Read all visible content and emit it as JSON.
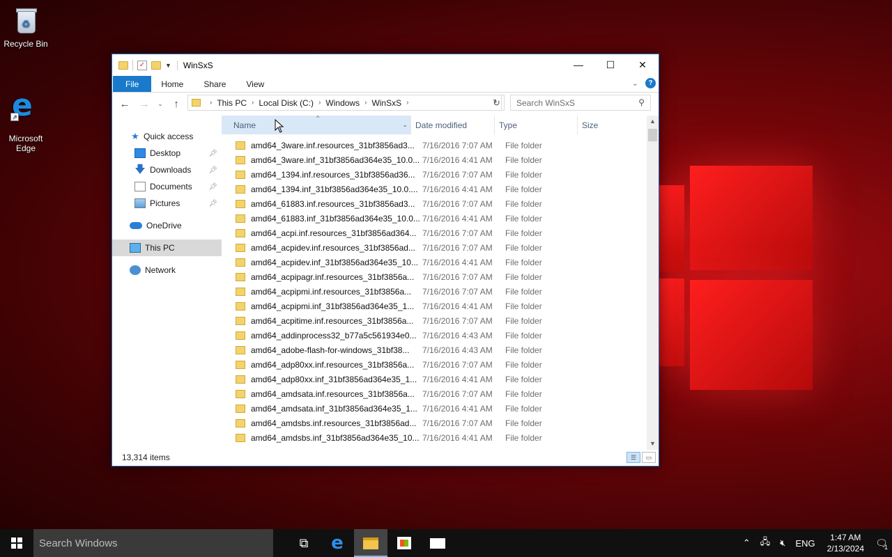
{
  "desktop": {
    "icons": [
      {
        "label": "Recycle Bin"
      },
      {
        "label": "Microsoft\nEdge"
      }
    ]
  },
  "window": {
    "title": "WinSxS",
    "ribbon_tabs": [
      "File",
      "Home",
      "Share",
      "View"
    ],
    "breadcrumbs": [
      "This PC",
      "Local Disk (C:)",
      "Windows",
      "WinSxS"
    ],
    "search_placeholder": "Search WinSxS",
    "columns": {
      "name": "Name",
      "date": "Date modified",
      "type": "Type",
      "size": "Size"
    },
    "sidebar": {
      "quick_access": "Quick access",
      "pinned": [
        "Desktop",
        "Downloads",
        "Documents",
        "Pictures"
      ],
      "onedrive": "OneDrive",
      "this_pc": "This PC",
      "network": "Network"
    },
    "files": [
      {
        "name": "amd64_3ware.inf.resources_31bf3856ad3...",
        "date": "7/16/2016 7:07 AM",
        "type": "File folder"
      },
      {
        "name": "amd64_3ware.inf_31bf3856ad364e35_10.0...",
        "date": "7/16/2016 4:41 AM",
        "type": "File folder"
      },
      {
        "name": "amd64_1394.inf.resources_31bf3856ad36...",
        "date": "7/16/2016 7:07 AM",
        "type": "File folder"
      },
      {
        "name": "amd64_1394.inf_31bf3856ad364e35_10.0....",
        "date": "7/16/2016 4:41 AM",
        "type": "File folder"
      },
      {
        "name": "amd64_61883.inf.resources_31bf3856ad3...",
        "date": "7/16/2016 7:07 AM",
        "type": "File folder"
      },
      {
        "name": "amd64_61883.inf_31bf3856ad364e35_10.0...",
        "date": "7/16/2016 4:41 AM",
        "type": "File folder"
      },
      {
        "name": "amd64_acpi.inf.resources_31bf3856ad364...",
        "date": "7/16/2016 7:07 AM",
        "type": "File folder"
      },
      {
        "name": "amd64_acpidev.inf.resources_31bf3856ad...",
        "date": "7/16/2016 7:07 AM",
        "type": "File folder"
      },
      {
        "name": "amd64_acpidev.inf_31bf3856ad364e35_10...",
        "date": "7/16/2016 4:41 AM",
        "type": "File folder"
      },
      {
        "name": "amd64_acpipagr.inf.resources_31bf3856a...",
        "date": "7/16/2016 7:07 AM",
        "type": "File folder"
      },
      {
        "name": "amd64_acpipmi.inf.resources_31bf3856a...",
        "date": "7/16/2016 7:07 AM",
        "type": "File folder"
      },
      {
        "name": "amd64_acpipmi.inf_31bf3856ad364e35_1...",
        "date": "7/16/2016 4:41 AM",
        "type": "File folder"
      },
      {
        "name": "amd64_acpitime.inf.resources_31bf3856a...",
        "date": "7/16/2016 7:07 AM",
        "type": "File folder"
      },
      {
        "name": "amd64_addinprocess32_b77a5c561934e0...",
        "date": "7/16/2016 4:43 AM",
        "type": "File folder"
      },
      {
        "name": "amd64_adobe-flash-for-windows_31bf38...",
        "date": "7/16/2016 4:43 AM",
        "type": "File folder"
      },
      {
        "name": "amd64_adp80xx.inf.resources_31bf3856a...",
        "date": "7/16/2016 7:07 AM",
        "type": "File folder"
      },
      {
        "name": "amd64_adp80xx.inf_31bf3856ad364e35_1...",
        "date": "7/16/2016 4:41 AM",
        "type": "File folder"
      },
      {
        "name": "amd64_amdsata.inf.resources_31bf3856a...",
        "date": "7/16/2016 7:07 AM",
        "type": "File folder"
      },
      {
        "name": "amd64_amdsata.inf_31bf3856ad364e35_1...",
        "date": "7/16/2016 4:41 AM",
        "type": "File folder"
      },
      {
        "name": "amd64_amdsbs.inf.resources_31bf3856ad...",
        "date": "7/16/2016 7:07 AM",
        "type": "File folder"
      },
      {
        "name": "amd64_amdsbs.inf_31bf3856ad364e35_10...",
        "date": "7/16/2016 4:41 AM",
        "type": "File folder"
      }
    ],
    "status": "13,314 items"
  },
  "taskbar": {
    "search_placeholder": "Search Windows",
    "language": "ENG",
    "time": "1:47 AM",
    "date": "2/13/2024",
    "notification_count": "1"
  },
  "colors": {
    "accent": "#1979ca",
    "wallpaper_red": "#a90d12",
    "taskbar": "#101010"
  }
}
